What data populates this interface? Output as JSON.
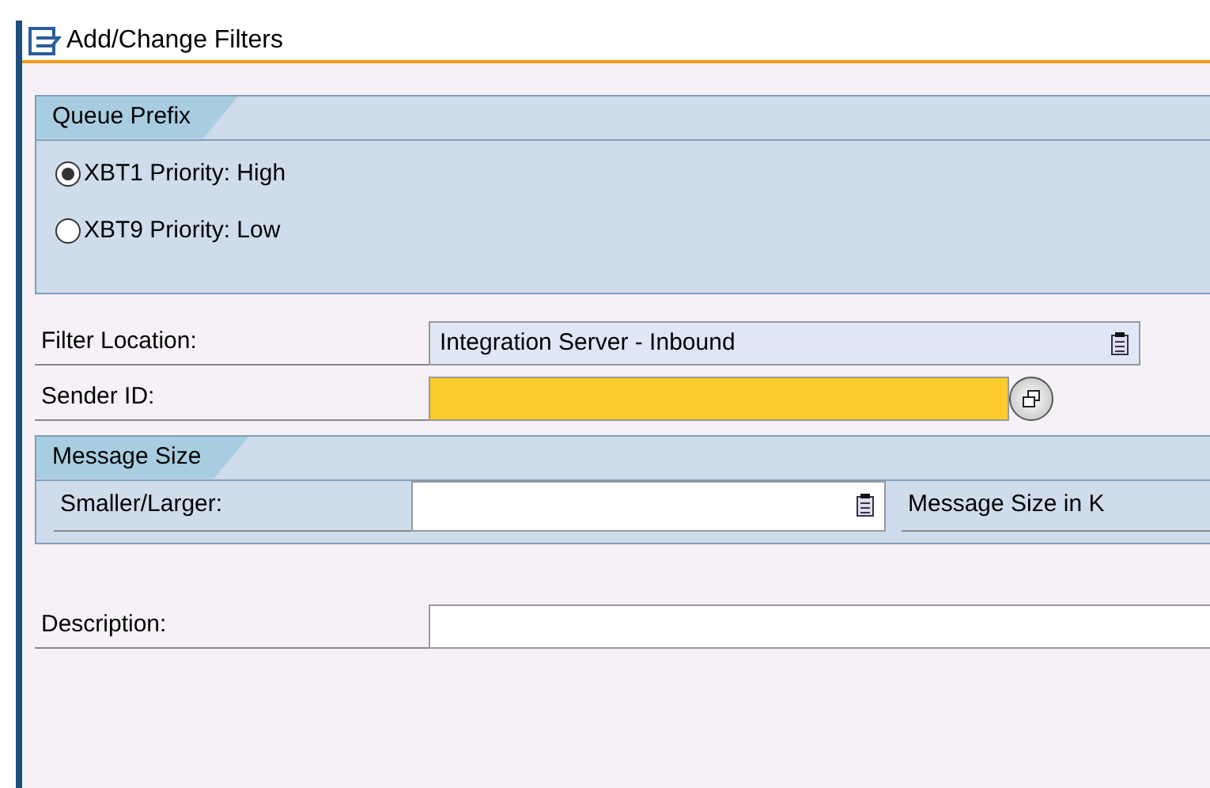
{
  "window": {
    "title": "Add/Change Filters"
  },
  "queue_prefix": {
    "title": "Queue Prefix",
    "options": [
      {
        "label": "XBT1 Priority: High",
        "selected": true
      },
      {
        "label": "XBT9 Priority: Low",
        "selected": false
      }
    ]
  },
  "filter_location": {
    "label": "Filter Location:",
    "value": "Integration Server - Inbound"
  },
  "sender_id": {
    "label": "Sender ID:",
    "required": true
  },
  "message_size": {
    "title": "Message Size",
    "comparison_label": "Smaller/Larger:",
    "size_label": "Message Size in K"
  },
  "description": {
    "label": "Description:"
  }
}
